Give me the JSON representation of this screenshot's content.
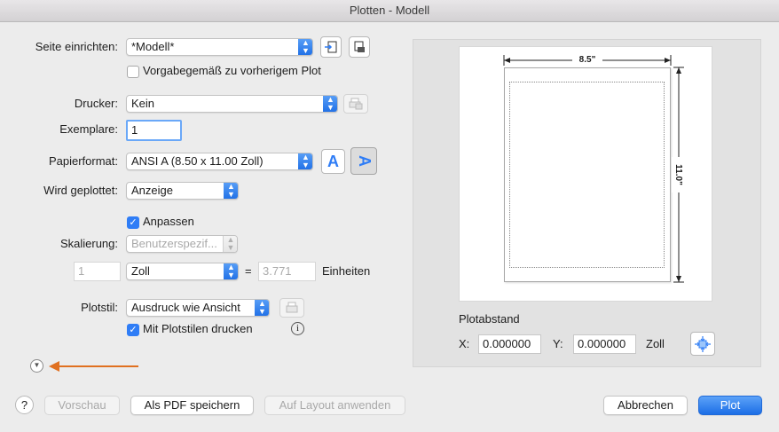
{
  "window": {
    "title": "Plotten - Modell"
  },
  "page_setup": {
    "label": "Seite einrichten:",
    "value": "*Modell*",
    "checkbox_label": "Vorgabegemäß zu vorherigem Plot"
  },
  "printer": {
    "label": "Drucker:",
    "value": "Kein"
  },
  "copies": {
    "label": "Exemplare:",
    "value": "1"
  },
  "paper": {
    "label": "Papierformat:",
    "value": "ANSI A (8.50 x 11.00 Zoll)",
    "orientation_portrait": "A",
    "orientation_landscape": "A"
  },
  "plot_area": {
    "label": "Wird geplottet:",
    "value": "Anzeige"
  },
  "fit": {
    "label": "Anpassen",
    "checked": true
  },
  "scale": {
    "label": "Skalierung:",
    "value": "Benutzerspezif...",
    "units_value": "1",
    "unit": "Zoll",
    "equals": "=",
    "drawing_units_value": "3.771",
    "units_label": "Einheiten"
  },
  "plot_style": {
    "label": "Plotstil:",
    "value": "Ausdruck wie Ansicht",
    "checkbox_label": "Mit Plotstilen drucken",
    "checked": true,
    "info": "i"
  },
  "preview": {
    "width_label": "8.5\"",
    "height_label": "11.0\""
  },
  "offset": {
    "title": "Plotabstand",
    "x_label": "X:",
    "x_value": "0.000000",
    "y_label": "Y:",
    "y_value": "0.000000",
    "unit": "Zoll"
  },
  "buttons": {
    "help": "?",
    "preview": "Vorschau",
    "save_pdf": "Als PDF speichern",
    "apply_layout": "Auf Layout anwenden",
    "cancel": "Abbrechen",
    "plot": "Plot"
  },
  "colors": {
    "accent": "#2f7df6",
    "arrow": "#e07020"
  }
}
